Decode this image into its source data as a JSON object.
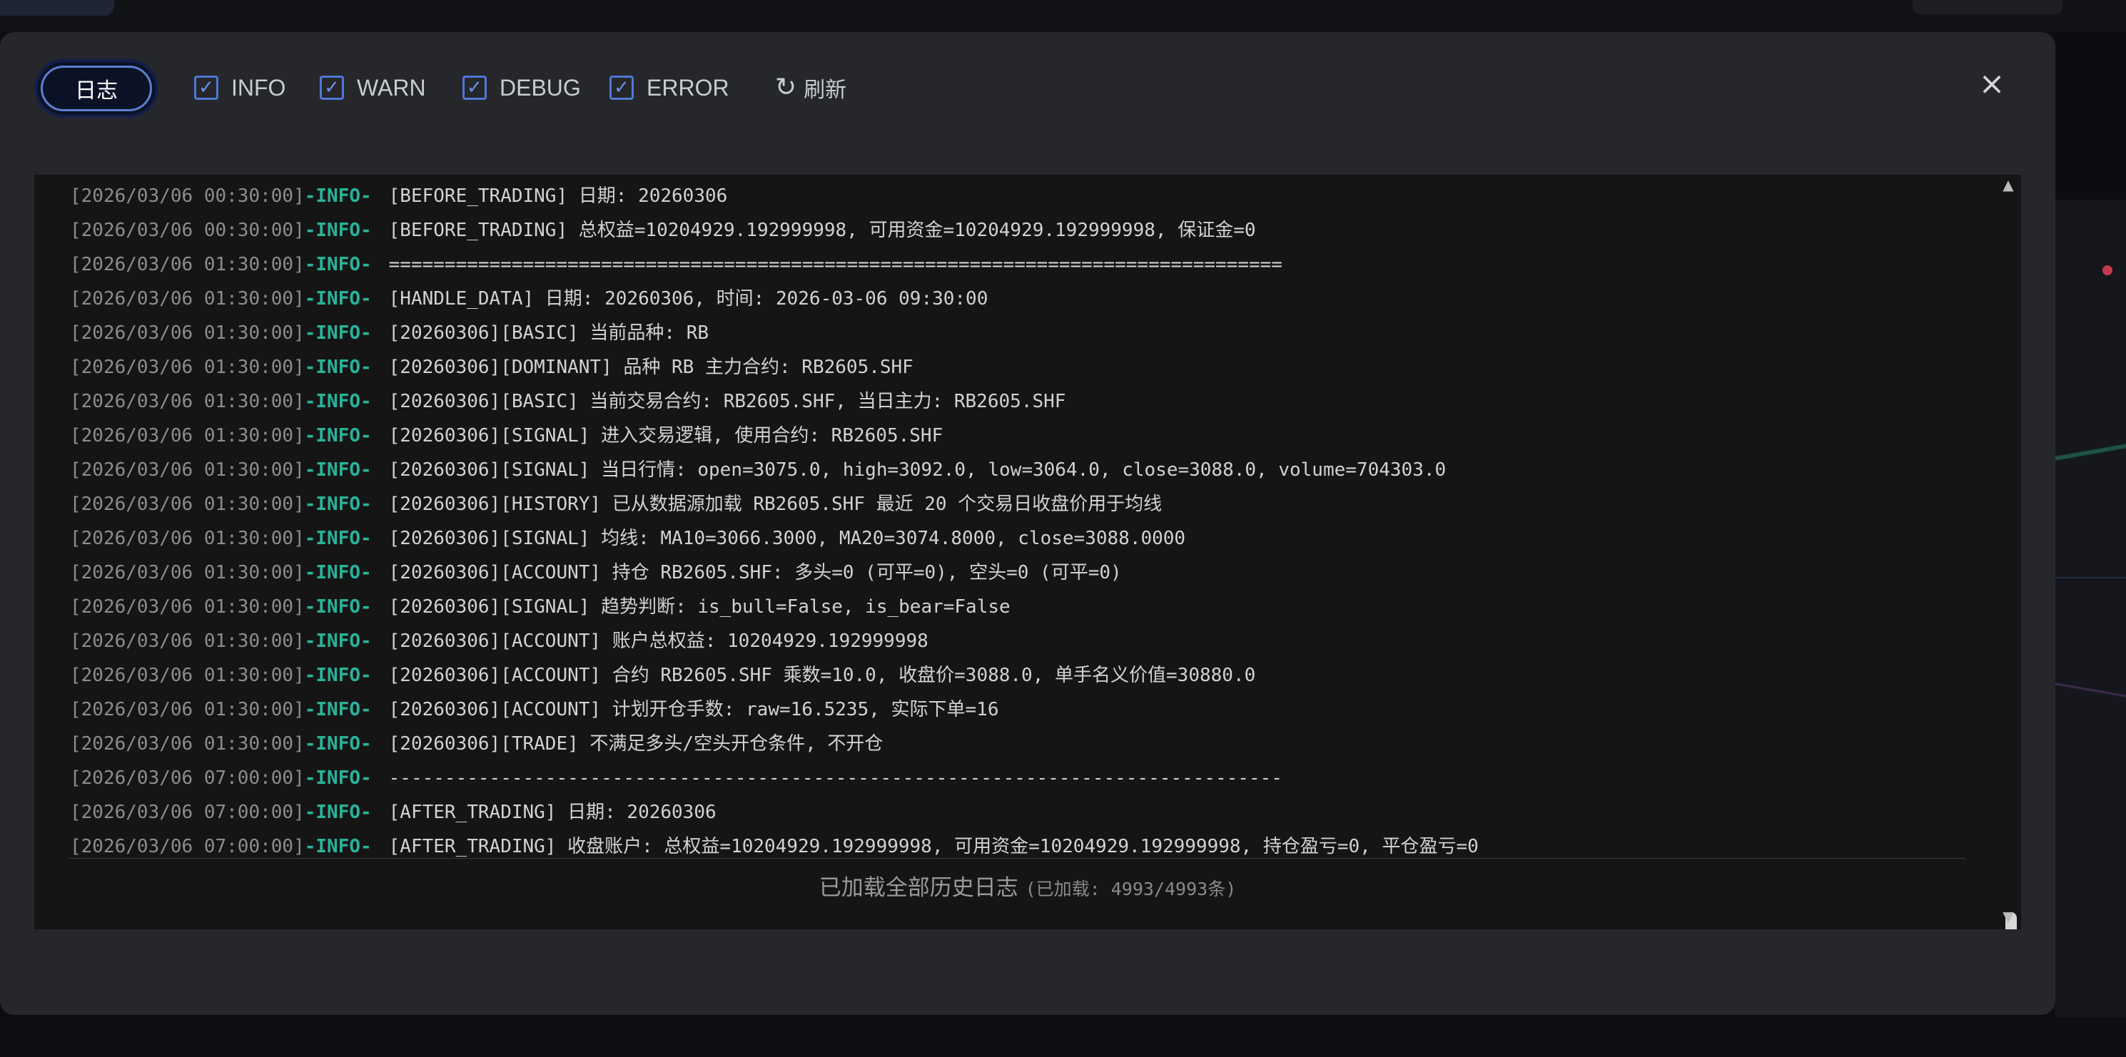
{
  "dialog": {
    "tab_label": "日志",
    "filters": [
      {
        "label": "INFO",
        "checked": true
      },
      {
        "label": "WARN",
        "checked": true
      },
      {
        "label": "DEBUG",
        "checked": true
      },
      {
        "label": "ERROR",
        "checked": true
      }
    ],
    "refresh_label": "刷新",
    "close_glyph": "×"
  },
  "log": {
    "lines": [
      {
        "ts": "[2026/03/06 00:30:00]",
        "level": "-INFO-",
        "msg": "[BEFORE_TRADING] 日期: 20260306"
      },
      {
        "ts": "[2026/03/06 00:30:00]",
        "level": "-INFO-",
        "msg": "[BEFORE_TRADING] 总权益=10204929.192999998, 可用资金=10204929.192999998, 保证金=0"
      },
      {
        "ts": "[2026/03/06 01:30:00]",
        "level": "-INFO-",
        "msg": "================================================================================"
      },
      {
        "ts": "[2026/03/06 01:30:00]",
        "level": "-INFO-",
        "msg": "[HANDLE_DATA] 日期: 20260306, 时间: 2026-03-06 09:30:00"
      },
      {
        "ts": "[2026/03/06 01:30:00]",
        "level": "-INFO-",
        "msg": "[20260306][BASIC] 当前品种: RB"
      },
      {
        "ts": "[2026/03/06 01:30:00]",
        "level": "-INFO-",
        "msg": "[20260306][DOMINANT] 品种 RB 主力合约: RB2605.SHF"
      },
      {
        "ts": "[2026/03/06 01:30:00]",
        "level": "-INFO-",
        "msg": "[20260306][BASIC] 当前交易合约: RB2605.SHF, 当日主力: RB2605.SHF"
      },
      {
        "ts": "[2026/03/06 01:30:00]",
        "level": "-INFO-",
        "msg": "[20260306][SIGNAL] 进入交易逻辑, 使用合约: RB2605.SHF"
      },
      {
        "ts": "[2026/03/06 01:30:00]",
        "level": "-INFO-",
        "msg": "[20260306][SIGNAL] 当日行情: open=3075.0, high=3092.0, low=3064.0, close=3088.0, volume=704303.0"
      },
      {
        "ts": "[2026/03/06 01:30:00]",
        "level": "-INFO-",
        "msg": "[20260306][HISTORY] 已从数据源加载 RB2605.SHF 最近 20 个交易日收盘价用于均线"
      },
      {
        "ts": "[2026/03/06 01:30:00]",
        "level": "-INFO-",
        "msg": "[20260306][SIGNAL] 均线: MA10=3066.3000, MA20=3074.8000, close=3088.0000"
      },
      {
        "ts": "[2026/03/06 01:30:00]",
        "level": "-INFO-",
        "msg": "[20260306][ACCOUNT] 持仓 RB2605.SHF: 多头=0 (可平=0), 空头=0 (可平=0)"
      },
      {
        "ts": "[2026/03/06 01:30:00]",
        "level": "-INFO-",
        "msg": "[20260306][SIGNAL] 趋势判断: is_bull=False, is_bear=False"
      },
      {
        "ts": "[2026/03/06 01:30:00]",
        "level": "-INFO-",
        "msg": "[20260306][ACCOUNT] 账户总权益: 10204929.192999998"
      },
      {
        "ts": "[2026/03/06 01:30:00]",
        "level": "-INFO-",
        "msg": "[20260306][ACCOUNT] 合约 RB2605.SHF 乘数=10.0, 收盘价=3088.0, 单手名义价值=30880.0"
      },
      {
        "ts": "[2026/03/06 01:30:00]",
        "level": "-INFO-",
        "msg": "[20260306][ACCOUNT] 计划开仓手数: raw=16.5235, 实际下单=16"
      },
      {
        "ts": "[2026/03/06 01:30:00]",
        "level": "-INFO-",
        "msg": "[20260306][TRADE] 不满足多头/空头开仓条件, 不开仓"
      },
      {
        "ts": "[2026/03/06 07:00:00]",
        "level": "-INFO-",
        "msg": "--------------------------------------------------------------------------------"
      },
      {
        "ts": "[2026/03/06 07:00:00]",
        "level": "-INFO-",
        "msg": "[AFTER_TRADING] 日期: 20260306"
      },
      {
        "ts": "[2026/03/06 07:00:00]",
        "level": "-INFO-",
        "msg": "[AFTER_TRADING] 收盘账户: 总权益=10204929.192999998, 可用资金=10204929.192999998, 持仓盈亏=0, 平仓盈亏=0"
      }
    ],
    "footer_text": "已加载全部历史日志",
    "footer_count": "(已加载: 4993/4993条)"
  },
  "colors": {
    "level_info": "#29b39a",
    "accent": "#4f78d6",
    "dialog_bg": "#26272b",
    "console_bg": "#151515"
  }
}
